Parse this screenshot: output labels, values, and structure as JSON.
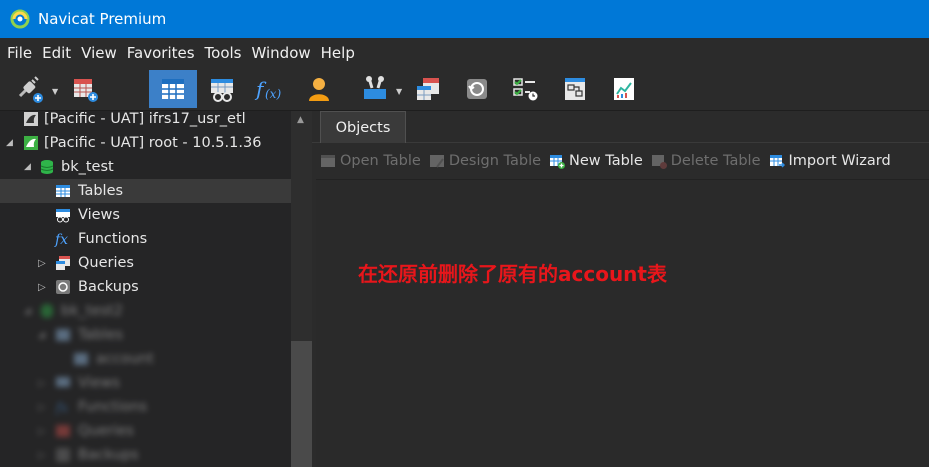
{
  "window": {
    "title": "Navicat Premium"
  },
  "menu": [
    "File",
    "Edit",
    "View",
    "Favorites",
    "Tools",
    "Window",
    "Help"
  ],
  "toolbar": {
    "buttons": [
      "connection-icon",
      "new-query-icon",
      "table-icon",
      "view-icon",
      "function-icon",
      "user-icon",
      "tools-icon",
      "query-icon",
      "backup-icon",
      "automation-icon",
      "model-icon",
      "chart-icon"
    ],
    "active": "table-icon"
  },
  "tree": {
    "conn1": "[Pacific - UAT] ifrs17_usr_etl",
    "conn2": "[Pacific - UAT] root - 10.5.1.36",
    "db": "bk_test",
    "tables": "Tables",
    "views": "Views",
    "functions": "Functions",
    "queries": "Queries",
    "backups": "Backups",
    "blurred": [
      "bk_test2",
      "Tables",
      "account",
      "Views",
      "Functions",
      "Queries",
      "Backups"
    ]
  },
  "tabs": [
    "Objects"
  ],
  "object_toolbar": {
    "open_table": "Open Table",
    "design_table": "Design Table",
    "new_table": "New Table",
    "delete_table": "Delete Table",
    "import_wizard": "Import Wizard"
  },
  "annotation": "在还原前删除了原有的account表",
  "colors": {
    "titlebar": "#0078d7",
    "selection": "#3c80c8",
    "annotation": "#e8161b",
    "db_green": "#2fb44a"
  }
}
